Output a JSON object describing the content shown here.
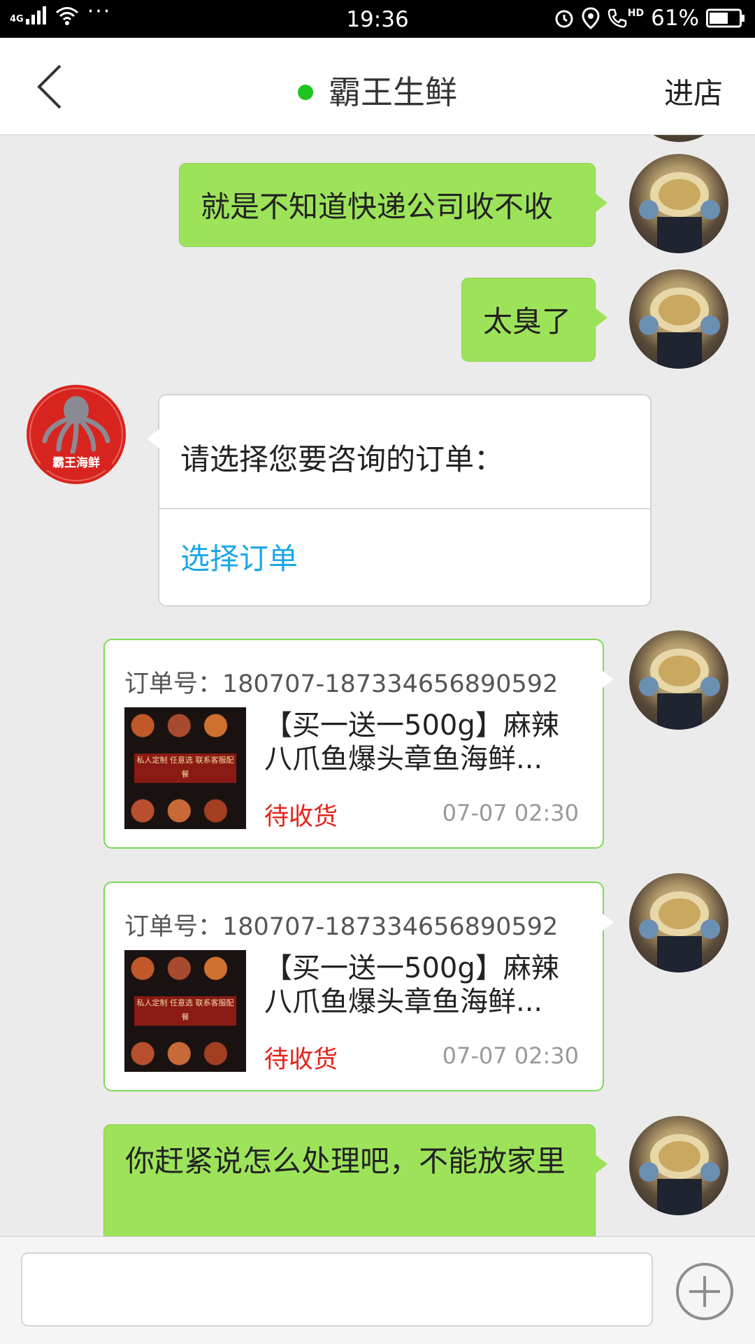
{
  "status_bar": {
    "network": "4G",
    "time": "19:36",
    "hd": "HD",
    "battery": "61%"
  },
  "header": {
    "title": "霸王生鲜",
    "enter_store": "进店"
  },
  "shop_avatar": {
    "logo_text": "霸王海鲜"
  },
  "messages": {
    "m1": "就是不知道快递公司收不收",
    "m2": "太臭了",
    "m3_prompt": "请选择您要咨询的订单：",
    "m3_action": "选择订单",
    "m6": "你赶紧说怎么处理吧，不能放家里"
  },
  "orders": [
    {
      "order_no": "订单号：180707-187334656890592",
      "title": "【买一送一500g】麻辣八爪鱼爆头章鱼海鲜...",
      "status": "待收货",
      "time": "07-07 02:30",
      "thumb_banner": "私人定制 任意选 联系客服配餐"
    },
    {
      "order_no": "订单号：180707-187334656890592",
      "title": "【买一送一500g】麻辣八爪鱼爆头章鱼海鲜...",
      "status": "待收货",
      "time": "07-07 02:30",
      "thumb_banner": "私人定制 任意选 联系客服配餐"
    }
  ],
  "input": {
    "placeholder": ""
  },
  "colors": {
    "accent_green": "#9de35a",
    "online_dot": "#1ec51e",
    "link_blue": "#1aa7e8",
    "status_red": "#e2231a"
  }
}
